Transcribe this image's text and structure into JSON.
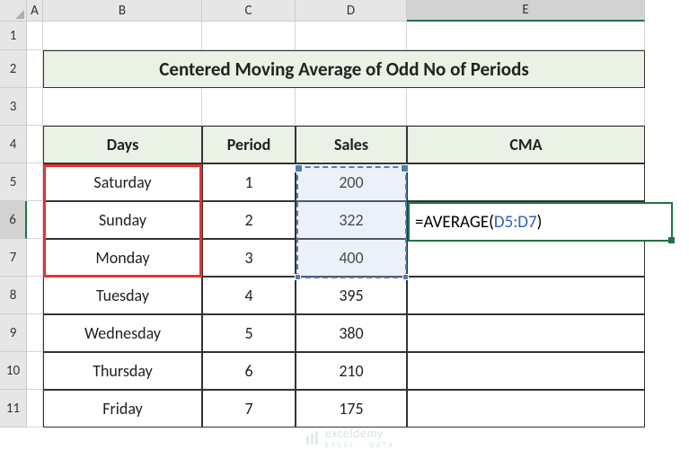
{
  "columns": [
    "A",
    "B",
    "C",
    "D",
    "E"
  ],
  "rows": [
    "1",
    "2",
    "3",
    "4",
    "5",
    "6",
    "7",
    "8",
    "9",
    "10",
    "11"
  ],
  "activeCol": "E",
  "activeRow": "6",
  "title": "Centered Moving Average of Odd No of Periods",
  "headers": {
    "days": "Days",
    "period": "Period",
    "sales": "Sales",
    "cma": "CMA"
  },
  "data": [
    {
      "day": "Saturday",
      "period": "1",
      "sales": "200"
    },
    {
      "day": "Sunday",
      "period": "2",
      "sales": "322"
    },
    {
      "day": "Monday",
      "period": "3",
      "sales": "400"
    },
    {
      "day": "Tuesday",
      "period": "4",
      "sales": "395"
    },
    {
      "day": "Wednesday",
      "period": "5",
      "sales": "380"
    },
    {
      "day": "Thursday",
      "period": "6",
      "sales": "210"
    },
    {
      "day": "Friday",
      "period": "7",
      "sales": "175"
    }
  ],
  "formula": {
    "prefix": "=AVERAGE(",
    "ref": "D5:D7",
    "suffix": ")"
  },
  "watermark": {
    "name": "exceldemy",
    "sub": "EXCEL · DATA ·"
  }
}
